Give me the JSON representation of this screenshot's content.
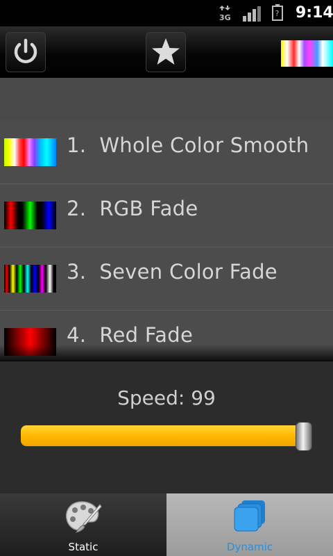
{
  "status_bar": {
    "network": "3G",
    "time": "9:14"
  },
  "toolbar": {
    "power_icon": "power-icon",
    "favorite_icon": "star-icon"
  },
  "effects": [
    {
      "number": "1.",
      "label": "Whole Color Smooth"
    },
    {
      "number": "2.",
      "label": "RGB Fade"
    },
    {
      "number": "3.",
      "label": "Seven Color Fade"
    },
    {
      "number": "4.",
      "label": "Red Fade"
    }
  ],
  "speed": {
    "label": "Speed: 99",
    "value": 99,
    "max": 100
  },
  "tabs": {
    "static_label": "Static",
    "dynamic_label": "Dynamic",
    "selected": "Dynamic"
  },
  "colors": {
    "slider": "#ffc000",
    "selected_tab_text": "#2a8fd8"
  }
}
